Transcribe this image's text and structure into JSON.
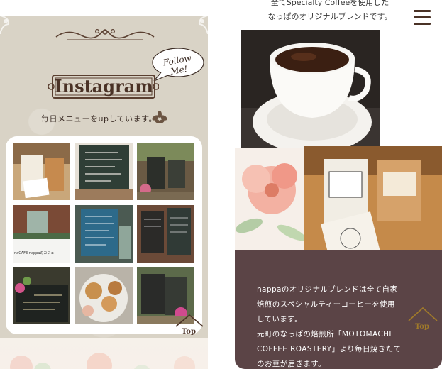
{
  "instagram": {
    "title": "Instagram",
    "follow_badge": "Follow Me!",
    "subtitle": "毎日メニューをupしています。",
    "grid_caption": "naCAFE nappaのカフェ"
  },
  "top_button": {
    "label": "Top"
  },
  "right": {
    "intro_line1": "全てSpecialty Coffeeを使用した",
    "intro_line2": "なっぱのオリジナルブレンドです。",
    "description": [
      "nappaのオリジナルブレンドは全て自家",
      "焙煎のスペシャルティーコーヒーを使用",
      "しています。",
      "元町のなっぱの焙煎所「MOTOMACHI",
      "COFFEE ROASTERY」より毎日焼きたて",
      "のお豆が届きます。"
    ]
  },
  "colors": {
    "panel_beige": "#d9d3c6",
    "brown_text": "#4a3226",
    "card_plum": "#5b4446",
    "top_gold": "#a07a2a"
  },
  "icons": [
    "menu-icon",
    "leaf-icon",
    "top-arrow-icon",
    "ornament-icon"
  ]
}
